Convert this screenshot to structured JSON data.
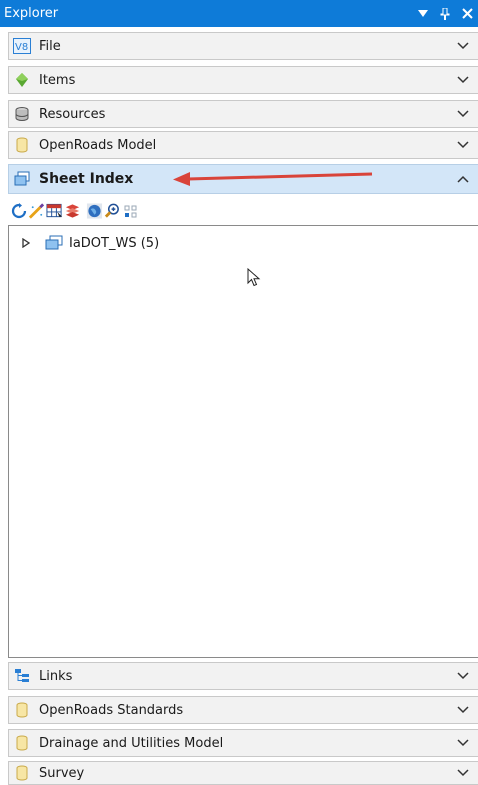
{
  "window": {
    "title": "Explorer",
    "dropdown_glyph": "▼",
    "pin_glyph": "⊥",
    "close_glyph": "✕"
  },
  "sections_top": [
    {
      "label": "File",
      "icon": "v8-file-icon",
      "chevron": "down"
    },
    {
      "label": "Items",
      "icon": "green-diamond-items-icon",
      "chevron": "down"
    },
    {
      "label": "Resources",
      "icon": "database-resources-icon",
      "chevron": "down"
    },
    {
      "label": "OpenRoads Model",
      "icon": "cylinder-model-icon",
      "chevron": "down"
    }
  ],
  "active_section": {
    "label": "Sheet Index",
    "icon": "sheet-index-icon",
    "chevron": "up"
  },
  "toolbar": {
    "tools": [
      "refresh-icon",
      "edit-wand-icon",
      "table-grid-icon",
      "layers-icon",
      "globe-icon",
      "zoom-icon",
      "dots-grid-icon"
    ]
  },
  "tree": {
    "items": [
      {
        "label": "IaDOT_WS (5)",
        "expanded": false
      }
    ]
  },
  "sections_bottom": [
    {
      "label": "Links",
      "icon": "links-tree-icon",
      "chevron": "down"
    },
    {
      "label": "OpenRoads Standards",
      "icon": "cylinder-standards-icon",
      "chevron": "down"
    },
    {
      "label": "Drainage and Utilities Model",
      "icon": "cylinder-drainage-icon",
      "chevron": "down"
    },
    {
      "label": "Survey",
      "icon": "cylinder-survey-icon",
      "chevron": "down"
    }
  ],
  "colors": {
    "titlebar": "#0e7bd8",
    "active_section": "#d3e6f8",
    "annotation_arrow": "#d9443a"
  }
}
